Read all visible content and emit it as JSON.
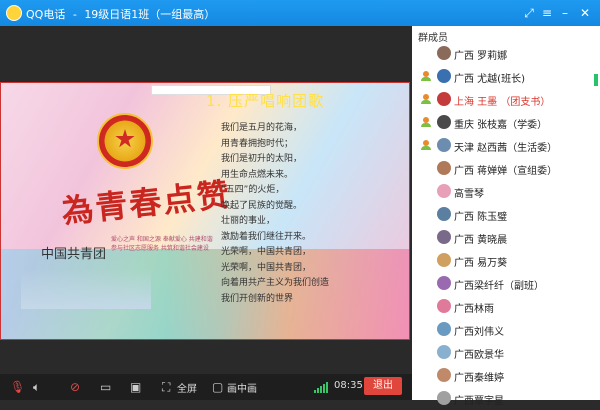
{
  "titlebar": {
    "app_name": "QQ电话",
    "separator": "-",
    "group": "19级日语1班（一组最高）"
  },
  "slide": {
    "headline": "1. 压严唱响团歌",
    "calligraphy": "為青春点赞",
    "corp_name": "中国共青团",
    "sub_lines": [
      "爱心之声 和国之源 奉献爱心 共建和谐",
      "参与社区志愿服务 共筑和谐社会建设"
    ],
    "poem": [
      "我们是五月的花海，",
      "用青春拥抱时代；",
      "我们是初升的太阳，",
      "用生命点燃未来。",
      "“五四”的火炬，",
      "唤起了民族的觉醒。",
      "壮丽的事业，",
      "激励着我们继往开来。",
      "光荣啊，中国共青团，",
      "光荣啊，中国共青团，",
      "向着用共产主义为我们创造",
      "我们开创新的世界"
    ]
  },
  "controls": {
    "fullscreen_label": "全屏",
    "pip_label": "画中画",
    "time": "08:35",
    "exit_label": "退出",
    "signal_color": "#3cc46a",
    "exit_color": "#e0463b"
  },
  "panel": {
    "header": "群成员",
    "members": [
      {
        "name": "广西 罗莉娜",
        "camera": false,
        "avatar_color": "#8a6b5a",
        "highlight": false
      },
      {
        "name": "广西 尤越(班长)",
        "camera": true,
        "avatar_color": "#3a6fb0",
        "highlight": false
      },
      {
        "name": "上海 王墨 （团支书）",
        "camera": true,
        "avatar_color": "#c43b3b",
        "highlight": true
      },
      {
        "name": "重庆 张枝嘉（学委）",
        "camera": true,
        "avatar_color": "#4a4a4a",
        "highlight": false
      },
      {
        "name": "天津 赵西茜（生活委）",
        "camera": true,
        "avatar_color": "#6c8db0",
        "highlight": false
      },
      {
        "name": "广西 蒋婵婵（宣组委）",
        "camera": false,
        "avatar_color": "#b07a5a",
        "highlight": false
      },
      {
        "name": "高雪琴",
        "camera": false,
        "avatar_color": "#e8a0b8",
        "highlight": false
      },
      {
        "name": "广西    陈玉璧",
        "camera": false,
        "avatar_color": "#5a7fa0",
        "highlight": false
      },
      {
        "name": "广西 黄晓晨",
        "camera": false,
        "avatar_color": "#7a6a8a",
        "highlight": false
      },
      {
        "name": "广西 易万葵",
        "camera": false,
        "avatar_color": "#d0a060",
        "highlight": false
      },
      {
        "name": "广西梁纤纤（副班）",
        "camera": false,
        "avatar_color": "#9a6ab0",
        "highlight": false
      },
      {
        "name": "广西林雨",
        "camera": false,
        "avatar_color": "#e07a9a",
        "highlight": false
      },
      {
        "name": "广西刘伟义",
        "camera": false,
        "avatar_color": "#6a9ac0",
        "highlight": false
      },
      {
        "name": "广西欧景华",
        "camera": false,
        "avatar_color": "#8ab0d0",
        "highlight": false
      },
      {
        "name": "广西秦维婷",
        "camera": false,
        "avatar_color": "#c08a6a",
        "highlight": false
      },
      {
        "name": "广西覃宇星",
        "camera": false,
        "avatar_color": "#a0a0a0",
        "highlight": false
      }
    ]
  }
}
